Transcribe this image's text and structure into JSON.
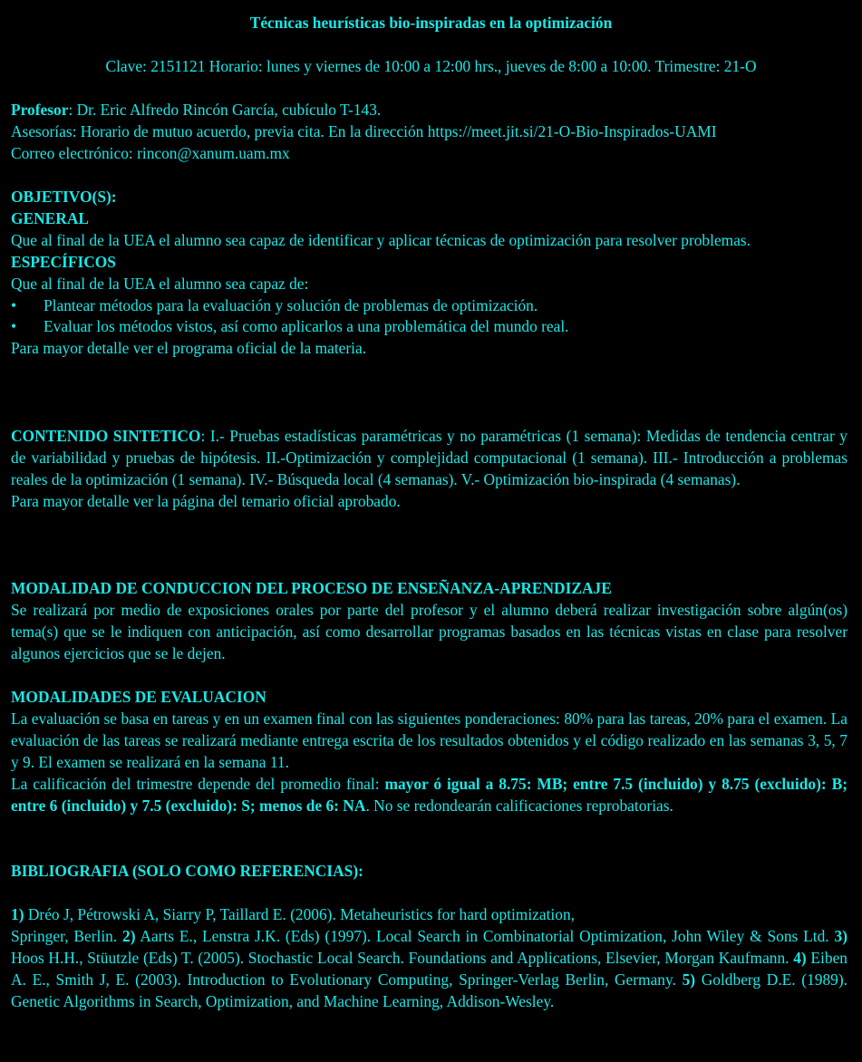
{
  "title": "Técnicas heurísticas bio-inspiradas en la optimización",
  "clave_line": "Clave: 2151121  Horario: lunes y viernes de 10:00 a 12:00 hrs., jueves de 8:00 a 10:00. Trimestre: 21-O",
  "profesor": {
    "label": "Profesor",
    "text": ": Dr. Eric Alfredo Rincón García, cubículo T-143.",
    "asesorias": "Asesorías: Horario de mutuo acuerdo, previa cita. En la dirección https://meet.jit.si/21-O-Bio-Inspirados-UAMI",
    "correo": "Correo electrónico: rincon@xanum.uam.mx"
  },
  "objetivos": {
    "heading": "OBJETIVO(S):",
    "general_heading": "GENERAL",
    "general_text": "Que al final de la UEA el alumno sea capaz de identificar y aplicar técnicas de optimización para resolver problemas.",
    "especificos_heading": "ESPECÍFICOS",
    "especificos_intro": "Que al final de la UEA el alumno sea capaz de:",
    "items": [
      "Plantear métodos para la evaluación y solución de problemas de optimización.",
      "Evaluar los métodos vistos, así como aplicarlos a una problemática del mundo real."
    ],
    "bullet": "•",
    "detalle": "Para mayor detalle ver el programa oficial de la materia."
  },
  "contenido": {
    "label": "CONTENIDO SINTETICO",
    "text": ": I.- Pruebas estadísticas paramétricas y no paramétricas (1 semana): Medidas de tendencia centrar y de variabilidad y pruebas de hipótesis.  II.-Optimización y complejidad computacional (1 semana). III.- Introducción a problemas reales de la optimización (1 semana). IV.- Búsqueda local (4 semanas). V.- Optimización bio-inspirada (4 semanas).",
    "detalle": "Para mayor detalle ver la página del temario oficial aprobado."
  },
  "modalidad": {
    "heading": "MODALIDAD DE CONDUCCION DEL PROCESO DE ENSEÑANZA-APRENDIZAJE",
    "text": "Se realizará por medio de exposiciones orales por parte del profesor y el alumno deberá realizar investigación sobre algún(os) tema(s) que se le indiquen con anticipación, así como desarrollar programas basados en las técnicas vistas en clase para resolver algunos ejercicios que se le dejen."
  },
  "evaluacion": {
    "heading": "MODALIDADES DE EVALUACION",
    "text": "La evaluación se basa en tareas y en un examen final con las siguientes ponderaciones: 80% para las tareas, 20% para el examen. La evaluación de las tareas se realizará mediante entrega escrita de los resultados obtenidos y el código realizado en las semanas 3, 5, 7 y 9. El examen se realizará en la semana 11.",
    "calif_pre": "La calificación del trimestre depende del promedio  final: ",
    "calif_bold": "mayor ó igual a 8.75: MB; entre 7.5 (incluido) y 8.75 (excluido): B; entre 6 (incluido) y 7.5 (excluido): S; menos de 6: NA",
    "calif_post": ". No se redondearán calificaciones reprobatorias."
  },
  "bibliografia": {
    "heading": "BIBLIOGRAFIA (SOLO COMO REFERENCIAS):",
    "n1": "1)",
    "r1a": " Dréo J, Pétrowski A, Siarry P, Taillard E. (2006). Metaheuristics for hard optimization,",
    "r1b": "Springer, Berlin. ",
    "n2": "2)",
    "r2": " Aarts E., Lenstra J.K. (Eds) (1997). Local Search in Combinatorial Optimization, John Wiley & Sons Ltd. ",
    "n3": "3)",
    "r3": " Hoos H.H., Stüutzle (Eds) T. (2005). Stochastic Local Search. Foundations and Applications, Elsevier, Morgan Kaufmann. ",
    "n4": "4)",
    "r4": " Eiben A. E., Smith J, E. (2003). Introduction to Evolutionary Computing, Springer-Verlag Berlin, Germany. ",
    "n5": "5)",
    "r5": " Goldberg D.E. (1989). Genetic Algorithms in Search, Optimization, and Machine Learning, Addison-Wesley."
  }
}
